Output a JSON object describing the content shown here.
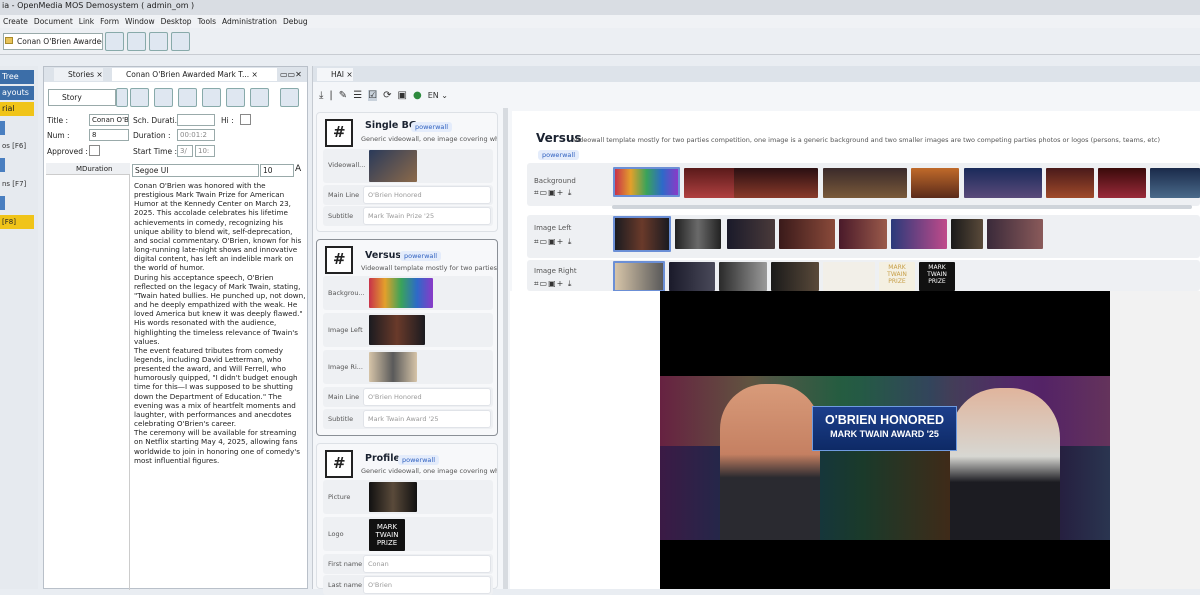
{
  "window": {
    "title": "ia - OpenMedia MOS Demosystem ( admin_om )"
  },
  "menu": [
    "Create",
    "Document",
    "Link",
    "Form",
    "Window",
    "Desktop",
    "Tools",
    "Administration",
    "Debug"
  ],
  "toolbar": {
    "doc_combo": "Conan O'Brien Awardec"
  },
  "leftnav": {
    "items": [
      "Tree",
      "ayouts",
      "rial",
      "os [F6]",
      "ns [F7]",
      "[F8]"
    ]
  },
  "stories_panel": {
    "tabs": [
      "Stories",
      "Conan O'Brien Awarded Mark T..."
    ],
    "type_combo": "Story",
    "labels": {
      "title": "Title :",
      "num": "Num :",
      "approved": "Approved :",
      "sch_duration": "Sch. Durati...",
      "duration": "Duration :",
      "start_time": "Start Time :",
      "hi": "Hi :"
    },
    "values": {
      "title": "Conan O'Bri",
      "num": "8",
      "duration": "00:01:2",
      "start_time_a": "3/",
      "start_time_b": "10:"
    },
    "col_header": "MDuration",
    "font_combo": "Segoe UI",
    "font_size": "10",
    "text": [
      "Conan O'Brien was honored with the prestigious Mark Twain Prize for American Humor at the Kennedy Center on March 23, 2025. This accolade celebrates his lifetime achievements in comedy, recognizing his unique ability to blend wit, self-deprecation, and social commentary. O'Brien, known for his long-running late-night shows and innovative digital content, has left an indelible mark on the world of humor.",
      "During his acceptance speech, O'Brien reflected on the legacy of Mark Twain, stating, \"Twain hated bullies. He punched up, not down, and he deeply empathized with the weak. He loved America but knew it was deeply flawed.\" His words resonated with the audience, highlighting the timeless relevance of Twain's values.",
      "The event featured tributes from comedy legends, including David Letterman, who presented the award, and Will Ferrell, who humorously quipped, \"I didn't budget enough time for this—I was supposed to be shutting down the Department of Education.\" The evening was a mix of heartfelt moments and laughter, with performances and anecdotes celebrating O'Brien's career.",
      "The ceremony will be available for streaming on Netflix starting May 4, 2025, allowing fans worldwide to join in honoring one of comedy's most influential figures."
    ]
  },
  "hai_panel": {
    "tab": "HAI",
    "lang": "EN",
    "templates": [
      {
        "title": "Single BG",
        "badge": "powerwall",
        "desc": "Generic videowall, one image covering whole ...",
        "fields": [
          {
            "label": "Videowall..."
          },
          {
            "label": "Main Line",
            "value": "O'Brien Honored"
          },
          {
            "label": "Subtitle",
            "value": "Mark Twain Prize '25"
          }
        ]
      },
      {
        "title": "Versus",
        "badge": "powerwall",
        "desc": "Videowall template mostly for two parties co...",
        "fields": [
          {
            "label": "Backgrou..."
          },
          {
            "label": "Image Left"
          },
          {
            "label": "Image Ri..."
          },
          {
            "label": "Main Line",
            "value": "O'Brien Honored"
          },
          {
            "label": "Subtitle",
            "value": "Mark Twain Award '25"
          }
        ]
      },
      {
        "title": "Profile",
        "badge": "powerwall",
        "desc": "Generic videowall, one image covering whole ...",
        "fields": [
          {
            "label": "Picture"
          },
          {
            "label": "Logo"
          },
          {
            "label": "First name",
            "value": "Conan"
          },
          {
            "label": "Last name",
            "value": "O'Brien"
          }
        ]
      }
    ],
    "logo_text": "MARK TWAIN PRIZE",
    "detail": {
      "title": "Versus",
      "desc": "Videowall template mostly for two parties competition, one image is a generic background and two smaller images are two competing parties photos or logos (persons, teams, etc)",
      "badge": "powerwall",
      "rows": [
        "Background",
        "Image Left",
        "Image Right"
      ]
    }
  },
  "preview": {
    "headline": "O'BRIEN HONORED",
    "subline": "MARK TWAIN AWARD '25"
  }
}
